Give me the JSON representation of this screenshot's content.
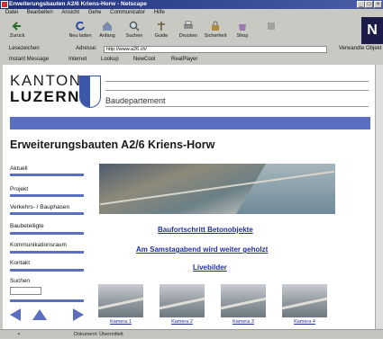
{
  "window": {
    "title": "Erweiterungsbauten A2/6 Kriens-Horw - Netscape"
  },
  "menu": [
    "Datei",
    "Bearbeiten",
    "Ansicht",
    "Gehe",
    "Communicator",
    "Hilfe"
  ],
  "toolbar": {
    "buttons": [
      "Zurück",
      "Neu laden",
      "Anfang",
      "Suchen",
      "Guide",
      "Drucken",
      "Sicherheit",
      "Shop"
    ],
    "icons": [
      "back-icon",
      "reload-icon",
      "home-icon",
      "search-icon",
      "guide-icon",
      "print-icon",
      "security-icon",
      "shop-icon"
    ]
  },
  "location": {
    "bookmarks_label": "Lesezeichen",
    "address_label": "Adresse:",
    "url": "http://www.a26.ch/",
    "related_label": "Verwandte Objekt"
  },
  "links_bar": [
    "Instant Message",
    "Internet",
    "Lookup",
    "NewCool",
    "RealPlayer"
  ],
  "header": {
    "kanton": "KANTON",
    "luzern": "LUZERN",
    "department": "Baudepartement"
  },
  "page_title": "Erweiterungsbauten A2/6 Kriens-Horw",
  "nav": {
    "items": [
      "Aktuell",
      "Projekt",
      "Verkehrs- / Bauphasen",
      "Baubeteiligte",
      "Kommunikationsraum",
      "Kontakt",
      "Suchen"
    ]
  },
  "content": {
    "links": [
      "Baufortschritt Betonobjekte",
      "Am Samstagabend wird weiter geholzt",
      "Livebilder"
    ],
    "cameras": [
      "Kamera 1",
      "Kamera 2",
      "Kamera 3",
      "Kamera 4"
    ]
  },
  "status": {
    "text": "Dokument: Übermittelt"
  },
  "colors": {
    "accent": "#5a6fc0",
    "link": "#1f2fa0",
    "titlebar": "#1e2f7a"
  }
}
